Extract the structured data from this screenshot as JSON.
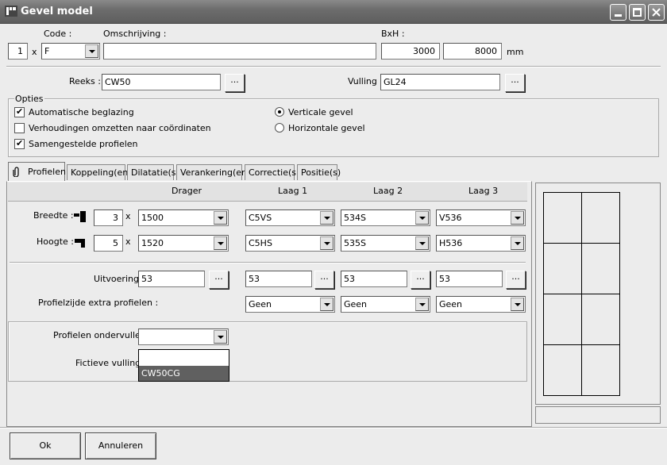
{
  "window": {
    "title": "Gevel model"
  },
  "top": {
    "code_label": "Code :",
    "omschrijving_label": "Omschrijving :",
    "bxh_label": "BxH :",
    "count_value": "1",
    "times": "x",
    "code_value": "F",
    "omschrijving_value": "",
    "width_value": "3000",
    "height_value": "8000",
    "unit": "mm"
  },
  "reeks": {
    "label": "Reeks :",
    "value": "CW50",
    "browse": "..."
  },
  "vulling": {
    "label": "Vulling :",
    "value": "GL24",
    "browse": "..."
  },
  "opties": {
    "legend": "Opties",
    "auto_beglazing": "Automatische beglazing",
    "verhoudingen": "Verhoudingen omzetten naar coördinaten",
    "samengestelde": "Samengestelde profielen",
    "verticale": "Verticale gevel",
    "horizontale": "Horizontale gevel"
  },
  "tabs": [
    "Profielen",
    "Koppeling(en)",
    "Dilatatie(s)",
    "Verankering(en)",
    "Correctie(s)",
    "Positie(s)"
  ],
  "grid": {
    "headers": [
      "Drager",
      "Laag 1",
      "Laag 2",
      "Laag 3"
    ],
    "breedte_label": "Breedte :",
    "breedte_count": "3",
    "breedte_values": [
      "1500",
      "C5VS",
      "534S",
      "V536"
    ],
    "hoogte_label": "Hoogte :",
    "hoogte_count": "5",
    "hoogte_values": [
      "1520",
      "C5HS",
      "535S",
      "H536"
    ],
    "times": "x",
    "uitvoering_label": "Uitvoering :",
    "uitvoering_values": [
      "53",
      "53",
      "53",
      "53"
    ],
    "profielzijde_label": "Profielzijde extra profielen :",
    "profielzijde_values": [
      "Geen",
      "Geen",
      "Geen"
    ],
    "browse": "..."
  },
  "onder": {
    "ondervullen_label": "Profielen ondervullen :",
    "ondervullen_value": "",
    "fictieve_label": "Fictieve vulling :",
    "dropdown_options": [
      "",
      "CW50CG"
    ]
  },
  "buttons": {
    "ok": "Ok",
    "annuleren": "Annuleren"
  }
}
